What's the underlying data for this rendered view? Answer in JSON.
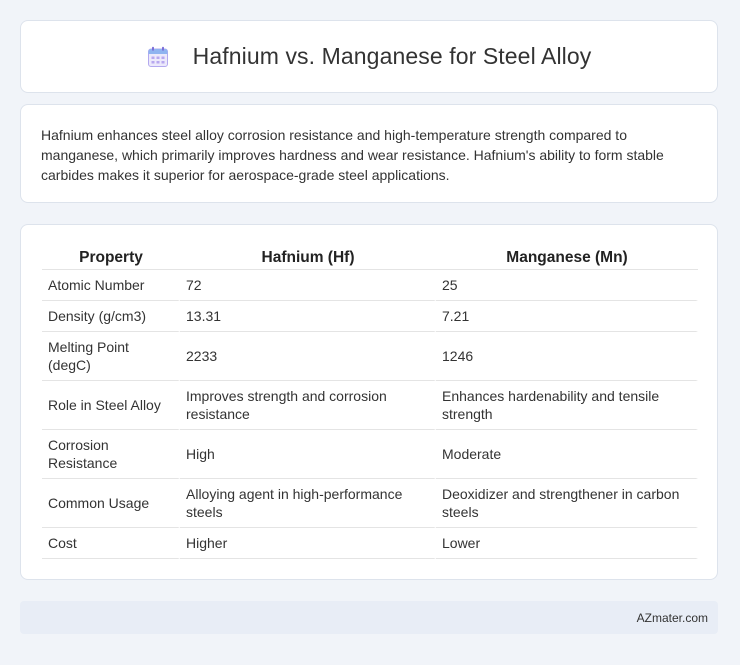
{
  "header": {
    "title": "Hafnium vs. Manganese for Steel Alloy",
    "icon": "calendar-icon"
  },
  "summary": {
    "text": "Hafnium enhances steel alloy corrosion resistance and high-temperature strength compared to manganese, which primarily improves hardness and wear resistance. Hafnium's ability to form stable carbides makes it superior for aerospace-grade steel applications."
  },
  "table": {
    "headers": [
      "Property",
      "Hafnium (Hf)",
      "Manganese (Mn)"
    ],
    "rows": [
      [
        "Atomic Number",
        "72",
        "25"
      ],
      [
        "Density (g/cm3)",
        "13.31",
        "7.21"
      ],
      [
        "Melting Point (degC)",
        "2233",
        "1246"
      ],
      [
        "Role in Steel Alloy",
        "Improves strength and corrosion resistance",
        "Enhances hardenability and tensile strength"
      ],
      [
        "Corrosion Resistance",
        "High",
        "Moderate"
      ],
      [
        "Common Usage",
        "Alloying agent in high-performance steels",
        "Deoxidizer and strengthener in carbon steels"
      ],
      [
        "Cost",
        "Higher",
        "Lower"
      ]
    ]
  },
  "footer": {
    "brand": "AZmater.com"
  },
  "colors": {
    "page_background": "#f1f4f9",
    "card_background": "#ffffff",
    "footer_background": "#e8edf6",
    "icon_accent": "#8a7fe0"
  }
}
